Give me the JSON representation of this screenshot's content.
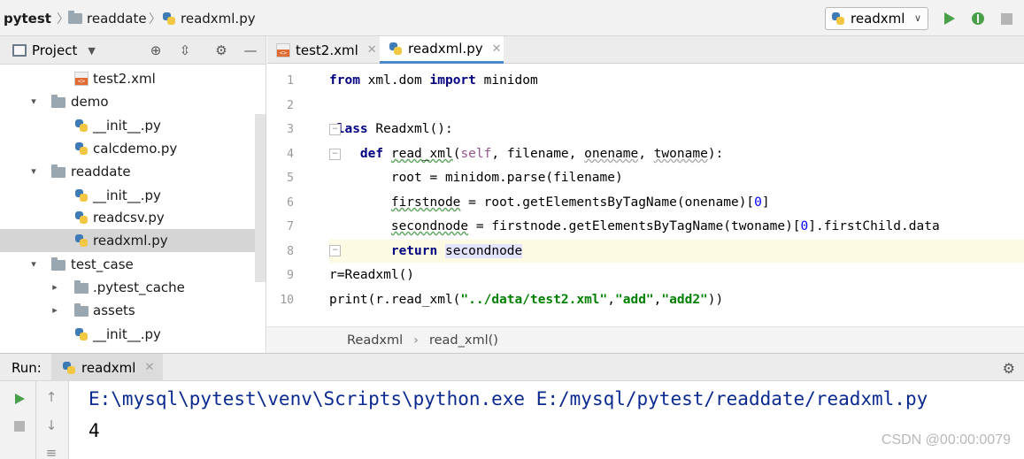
{
  "navbar": {
    "crumbs": [
      "pytest",
      "readdate",
      "readxml.py"
    ],
    "run_config": "readxml",
    "actions": [
      "run-icon",
      "debug-icon",
      "stop-icon"
    ]
  },
  "project": {
    "title": "Project",
    "tree": [
      {
        "label": "test2.xml",
        "icon": "xml-file-icon"
      },
      {
        "label": "demo",
        "icon": "folder-icon",
        "expanded": true
      },
      {
        "label": "__init__.py",
        "icon": "python-file-icon"
      },
      {
        "label": "calcdemo.py",
        "icon": "python-file-icon"
      },
      {
        "label": "readdate",
        "icon": "folder-icon",
        "expanded": true
      },
      {
        "label": "__init__.py",
        "icon": "python-file-icon"
      },
      {
        "label": "readcsv.py",
        "icon": "python-file-icon"
      },
      {
        "label": "readxml.py",
        "icon": "python-file-icon",
        "selected": true
      },
      {
        "label": "test_case",
        "icon": "folder-icon",
        "expanded": true
      },
      {
        "label": ".pytest_cache",
        "icon": "folder-icon",
        "expanded": false
      },
      {
        "label": "assets",
        "icon": "folder-icon",
        "expanded": false
      },
      {
        "label": "__init__.py",
        "icon": "python-file-icon"
      }
    ]
  },
  "editor": {
    "tabs": [
      {
        "label": "test2.xml",
        "icon": "xml-file-icon",
        "active": false
      },
      {
        "label": "readxml.py",
        "icon": "python-file-icon",
        "active": true
      }
    ],
    "line_numbers": [
      "1",
      "2",
      "3",
      "4",
      "5",
      "6",
      "7",
      "8",
      "9",
      "10"
    ],
    "code": [
      "from xml.dom import minidom",
      "",
      "class Readxml():",
      "    def read_xml(self, filename, onename, twoname):",
      "        root = minidom.parse(filename)",
      "        firstnode = root.getElementsByTagName(onename)[0]",
      "        secondnode = firstnode.getElementsByTagName(twoname)[0].firstChild.data",
      "        return secondnode",
      "r=Readxml()",
      "print(r.read_xml(\"../data/test2.xml\",\"add\",\"add2\"))"
    ],
    "breadcrumb": [
      "Readxml",
      "read_xml()"
    ]
  },
  "run": {
    "label": "Run:",
    "tab": "readxml",
    "output": [
      "E:\\mysql\\pytest\\venv\\Scripts\\python.exe E:/mysql/pytest/readdate/readxml.py",
      "4"
    ]
  },
  "watermark": "CSDN @00:00:0079",
  "colors": {
    "keyword": "#000080",
    "string": "#008000",
    "number": "#0000ff",
    "self": "#94558d",
    "console_text": "#0b2a8f",
    "run_green": "#4aa04a",
    "tab_underline": "#4a88c7"
  }
}
